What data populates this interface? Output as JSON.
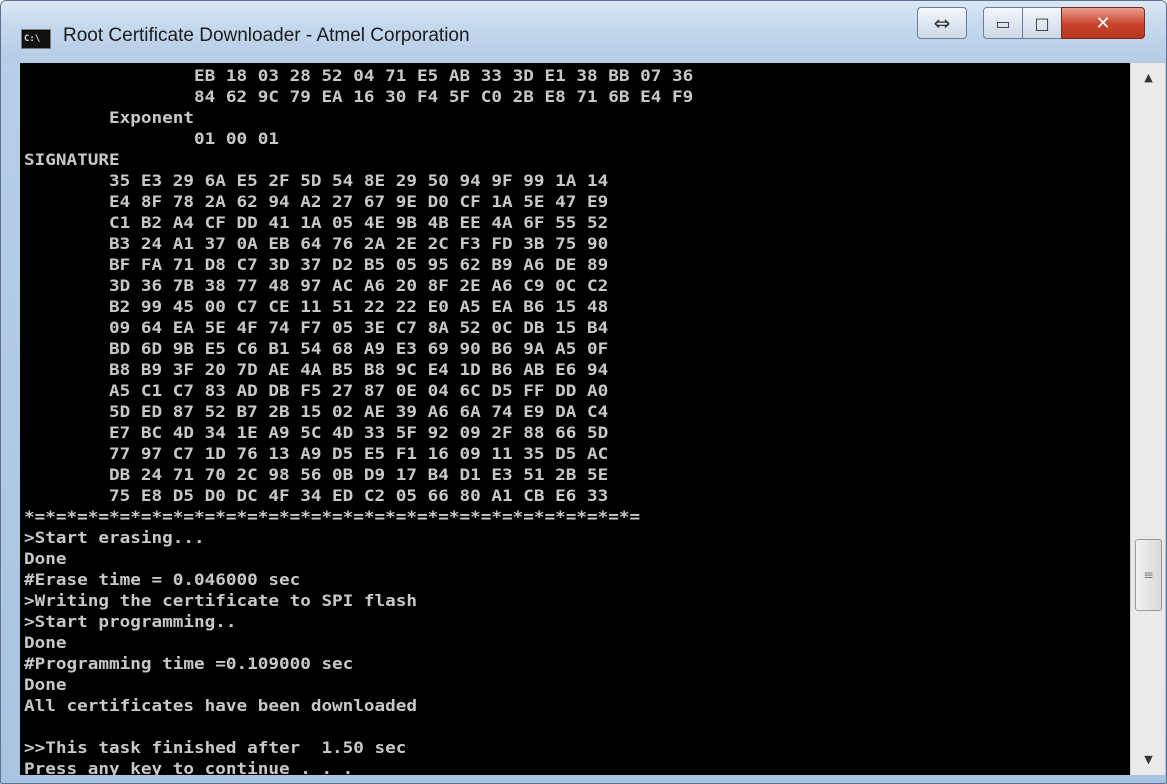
{
  "window": {
    "icon_label": "C:\\",
    "title": "Root Certificate Downloader - Atmel Corporation",
    "buttons": {
      "resize_glyph": "⇔",
      "minimize_glyph": "▭",
      "maximize_glyph": "□",
      "close_glyph": "✕"
    }
  },
  "console": {
    "text": "                EB 18 03 28 52 04 71 E5 AB 33 3D E1 38 BB 07 36\n                84 62 9C 79 EA 16 30 F4 5F C0 2B E8 71 6B E4 F9\n        Exponent\n                01 00 01\nSIGNATURE\n        35 E3 29 6A E5 2F 5D 54 8E 29 50 94 9F 99 1A 14\n        E4 8F 78 2A 62 94 A2 27 67 9E D0 CF 1A 5E 47 E9\n        C1 B2 A4 CF DD 41 1A 05 4E 9B 4B EE 4A 6F 55 52\n        B3 24 A1 37 0A EB 64 76 2A 2E 2C F3 FD 3B 75 90\n        BF FA 71 D8 C7 3D 37 D2 B5 05 95 62 B9 A6 DE 89\n        3D 36 7B 38 77 48 97 AC A6 20 8F 2E A6 C9 0C C2\n        B2 99 45 00 C7 CE 11 51 22 22 E0 A5 EA B6 15 48\n        09 64 EA 5E 4F 74 F7 05 3E C7 8A 52 0C DB 15 B4\n        BD 6D 9B E5 C6 B1 54 68 A9 E3 69 90 B6 9A A5 0F\n        B8 B9 3F 20 7D AE 4A B5 B8 9C E4 1D B6 AB E6 94\n        A5 C1 C7 83 AD DB F5 27 87 0E 04 6C D5 FF DD A0\n        5D ED 87 52 B7 2B 15 02 AE 39 A6 6A 74 E9 DA C4\n        E7 BC 4D 34 1E A9 5C 4D 33 5F 92 09 2F 88 66 5D\n        77 97 C7 1D 76 13 A9 D5 E5 F1 16 09 11 35 D5 AC\n        DB 24 71 70 2C 98 56 0B D9 17 B4 D1 E3 51 2B 5E\n        75 E8 D5 D0 DC 4F 34 ED C2 05 66 80 A1 CB E6 33\n*=*=*=*=*=*=*=*=*=*=*=*=*=*=*=*=*=*=*=*=*=*=*=*=*=*=*=*=*=\n>Start erasing...\nDone\n#Erase time = 0.046000 sec\n>Writing the certificate to SPI flash\n>Start programming..\nDone\n#Programming time =0.109000 sec\nDone\nAll certificates have been downloaded\n\n>>This task finished after  1.50 sec\nPress any key to continue . . . _"
  },
  "scrollbar": {
    "up_glyph": "▲",
    "down_glyph": "▼",
    "thumb_grip": "≡"
  }
}
